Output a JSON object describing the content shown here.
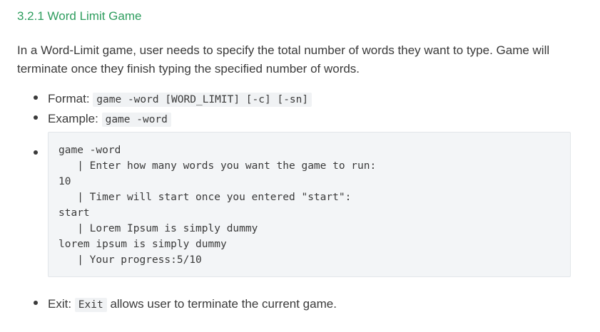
{
  "section": {
    "heading": "3.2.1 Word Limit Game",
    "intro": "In a Word-Limit game, user needs to specify the total number of words they want to type. Game will terminate once they finish typing the specified number of words."
  },
  "bullets": {
    "format_label": "Format: ",
    "format_code": "game -word [WORD_LIMIT] [-c] [-sn]",
    "example_label": "Example: ",
    "example_code": "game -word",
    "exit_label": "Exit: ",
    "exit_code": "Exit",
    "exit_text": " allows user to terminate the current game."
  },
  "code_block": {
    "lines": [
      "game -word",
      "   | Enter how many words you want the game to run:",
      "10",
      "   | Timer will start once you entered \"start\":",
      "start",
      "   | Lorem Ipsum is simply dummy",
      "lorem ipsum is simply dummy",
      "   | Your progress:5/10"
    ]
  }
}
